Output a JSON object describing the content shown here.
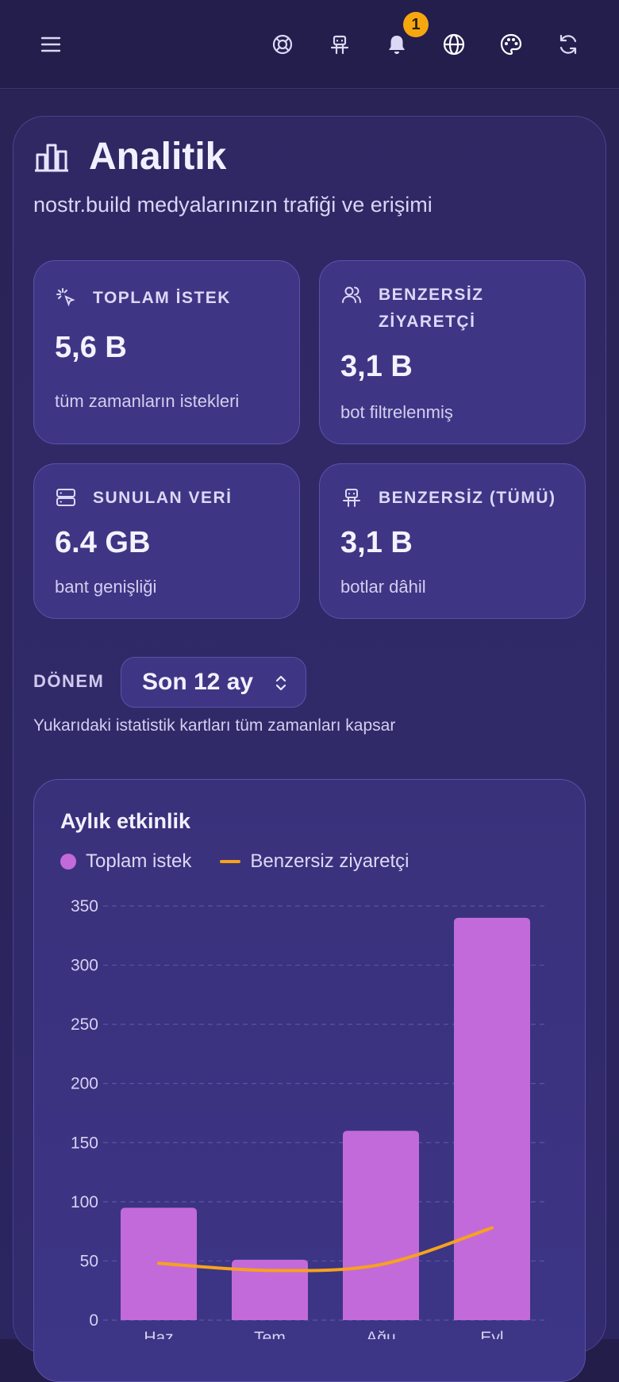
{
  "header": {
    "notification_count": "1",
    "icons": [
      "menu-icon",
      "lifebuoy-icon",
      "robot-icon",
      "bell-icon",
      "globe-icon",
      "palette-icon",
      "refresh-icon"
    ]
  },
  "page": {
    "title": "Analitik",
    "subtitle": "nostr.build medyalarınızın trafiği ve erişimi"
  },
  "stats": [
    {
      "icon": "pointer-click-icon",
      "label": "TOPLAM İSTEK",
      "value": "5,6 B",
      "note": "tüm zamanların istekleri"
    },
    {
      "icon": "users-icon",
      "label": "BENZERSİZ ZİYARETÇİ",
      "value": "3,1 B",
      "note": "bot filtrelenmiş"
    },
    {
      "icon": "server-icon",
      "label": "SUNULAN VERİ",
      "value": "6.4 GB",
      "note": "bant genişliği"
    },
    {
      "icon": "robot-icon",
      "label": "BENZERSİZ (TÜMÜ)",
      "value": "3,1 B",
      "note": "botlar dâhil"
    }
  ],
  "period": {
    "label": "DÖNEM",
    "selected": "Son 12 ay",
    "note": "Yukarıdaki istatistik kartları tüm zamanları kapsar"
  },
  "chart": {
    "title": "Aylık etkinlik",
    "colors": {
      "bars": "#c36ada",
      "line": "#f7a21b"
    }
  },
  "chart_data": {
    "type": "bar",
    "title": "Aylık etkinlik",
    "categories": [
      "Haz",
      "Tem",
      "Ağu",
      "Eyl"
    ],
    "series": [
      {
        "name": "Toplam istek",
        "type": "bar",
        "values": [
          95,
          51,
          160,
          340
        ]
      },
      {
        "name": "Benzersiz ziyaretçi",
        "type": "line",
        "values": [
          48,
          42,
          47,
          78
        ]
      }
    ],
    "ylim": [
      0,
      350
    ],
    "yticks": [
      0,
      50,
      100,
      150,
      200,
      250,
      300,
      350
    ],
    "grid": true,
    "legend": "top-left"
  }
}
